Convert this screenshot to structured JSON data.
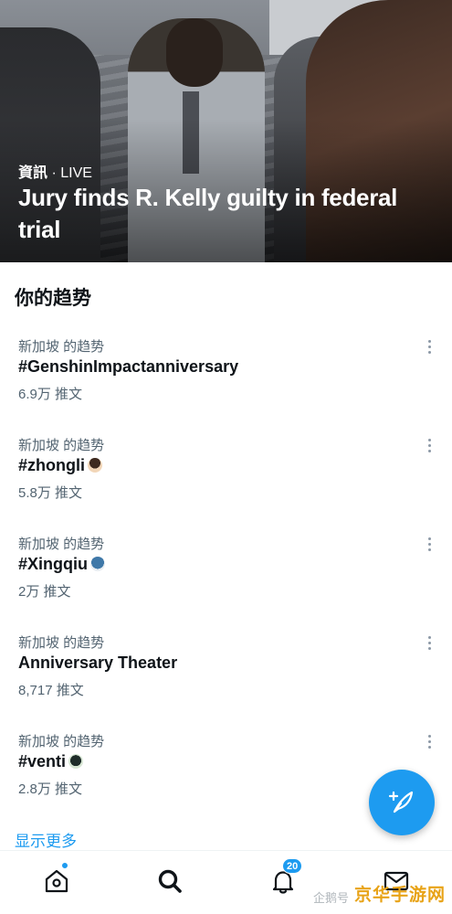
{
  "hero": {
    "category": "資訊",
    "live": "· LIVE",
    "headline": "Jury finds R. Kelly guilty in federal trial"
  },
  "section": {
    "title": "你的趋势"
  },
  "trends": [
    {
      "location": "新加坡 的趋势",
      "name": "#GenshinImpactanniversary",
      "count": "6.9万 推文",
      "emoji": ""
    },
    {
      "location": "新加坡 的趋势",
      "name": "#zhongli",
      "count": "5.8万 推文",
      "emoji": "zhongli-avatar"
    },
    {
      "location": "新加坡 的趋势",
      "name": "#Xingqiu",
      "count": "2万 推文",
      "emoji": "xingqiu-avatar"
    },
    {
      "location": "新加坡 的趋势",
      "name": "Anniversary Theater",
      "count": "8,717 推文",
      "emoji": ""
    },
    {
      "location": "新加坡 的趋势",
      "name": "#venti",
      "count": "2.8万 推文",
      "emoji": "venti-avatar"
    }
  ],
  "show_more": "显示更多",
  "nav": {
    "items": [
      "home-icon",
      "search-icon",
      "notifications-icon",
      "messages-icon"
    ],
    "notification_count": "20"
  },
  "fab": {
    "icon": "compose-feather-icon"
  },
  "watermark": {
    "text": "企鹅号",
    "brand": "京华手游网"
  },
  "colors": {
    "accent": "#1d9bf0",
    "text": "#0f1419",
    "secondary": "#536471"
  }
}
